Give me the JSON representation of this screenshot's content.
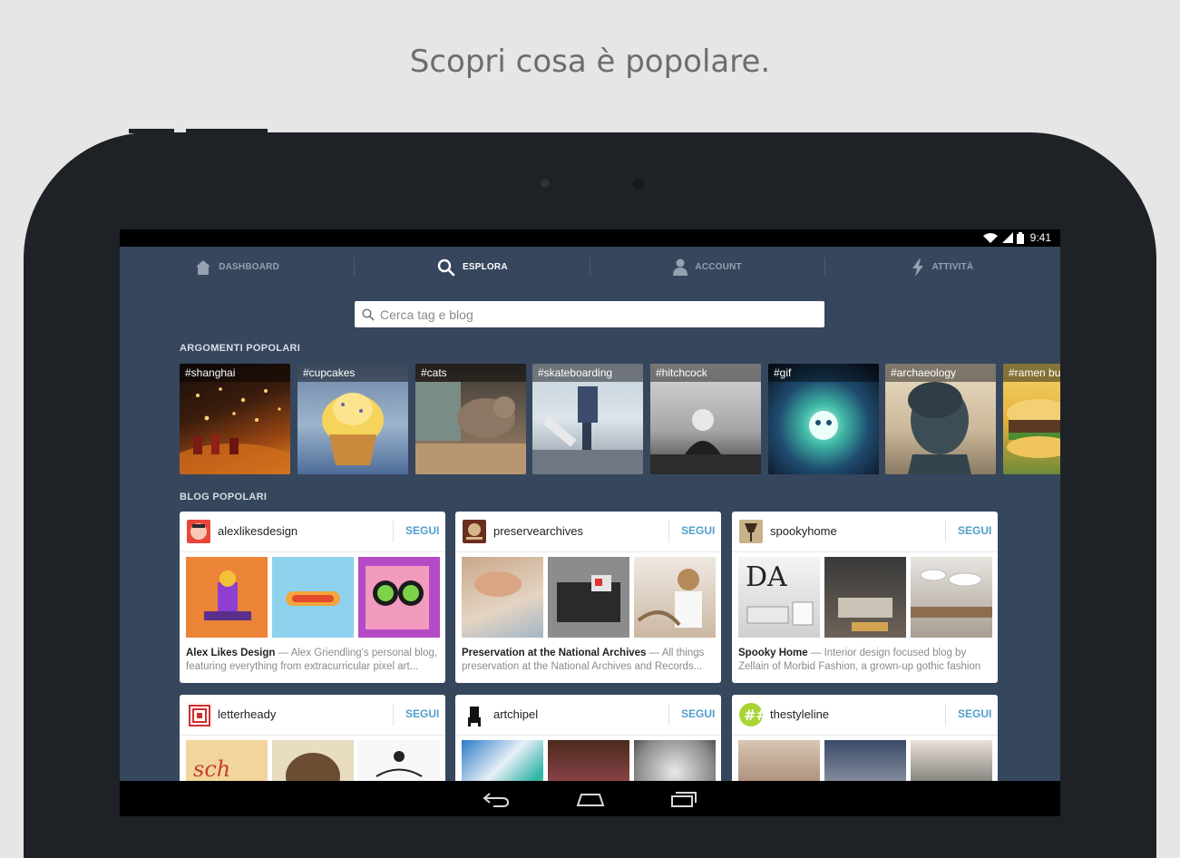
{
  "tagline": "Scopri cosa è popolare.",
  "status": {
    "time": "9:41"
  },
  "nav": {
    "tabs": [
      {
        "label": "DASHBOARD",
        "icon": "home-icon",
        "active": false
      },
      {
        "label": "ESPLORA",
        "icon": "search-icon",
        "active": true
      },
      {
        "label": "ACCOUNT",
        "icon": "person-icon",
        "active": false
      },
      {
        "label": "ATTIVITÀ",
        "icon": "lightning-icon",
        "active": false
      }
    ]
  },
  "search": {
    "placeholder": "Cerca tag e blog"
  },
  "topics": {
    "title": "ARGOMENTI POPOLARI",
    "items": [
      "#shanghai",
      "#cupcakes",
      "#cats",
      "#skateboarding",
      "#hitchcock",
      "#gif",
      "#archaeology",
      "#ramen bur"
    ]
  },
  "blogs": {
    "title": "BLOG POPOLARI",
    "follow_label": "SEGUI",
    "items": [
      {
        "name": "alexlikesdesign",
        "title": "Alex Likes Design",
        "desc_line1": " — Alex Griendling's personal blog,",
        "desc_line2": "featuring everything from extracurricular pixel art..."
      },
      {
        "name": "preservearchives",
        "title": "Preservation at the National Archives",
        "desc_line1": " — All things",
        "desc_line2": "preservation at the National Archives and Records..."
      },
      {
        "name": "spookyhome",
        "title": "Spooky Home",
        "desc_line1": " — Interior design focused blog by",
        "desc_line2": "Zellain of Morbid Fashion, a grown-up gothic fashion"
      },
      {
        "name": "letterheady",
        "title": "",
        "desc_line1": "",
        "desc_line2": ""
      },
      {
        "name": "artchipel",
        "title": "",
        "desc_line1": "",
        "desc_line2": ""
      },
      {
        "name": "thestyleline",
        "title": "",
        "desc_line1": "",
        "desc_line2": ""
      }
    ]
  },
  "colors": {
    "screen_bg": "#36465d",
    "accent": "#529ecc",
    "bezel": "#1e2226"
  }
}
